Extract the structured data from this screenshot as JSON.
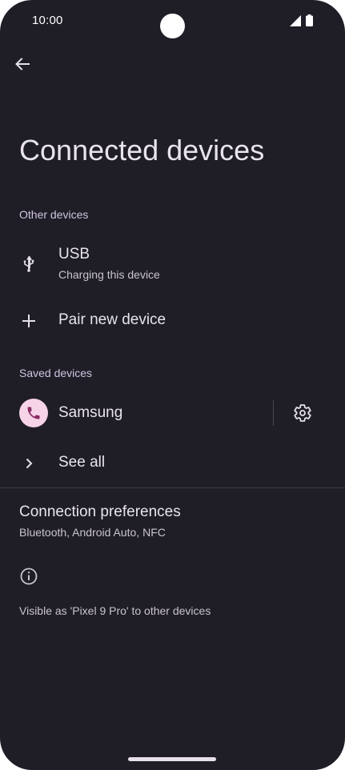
{
  "status_bar": {
    "time": "10:00"
  },
  "header": {
    "title": "Connected devices",
    "back_icon": "arrow-back-icon"
  },
  "sections": {
    "other_devices": "Other devices",
    "saved_devices": "Saved devices"
  },
  "usb": {
    "title": "USB",
    "subtitle": "Charging this device",
    "icon": "usb-icon"
  },
  "pair": {
    "title": "Pair new device",
    "icon": "plus-icon"
  },
  "saved_device": {
    "name": "Samsung",
    "icon": "phone-icon",
    "settings_icon": "gear-icon"
  },
  "see_all": {
    "label": "See all",
    "icon": "chevron-right-icon"
  },
  "preferences": {
    "title": "Connection preferences",
    "subtitle": "Bluetooth, Android Auto, NFC"
  },
  "footer": {
    "visible_as": "Visible as 'Pixel 9 Pro' to other devices",
    "icon": "info-icon"
  },
  "colors": {
    "background": "#1f1d26",
    "avatar_bg": "#f7d3e8",
    "avatar_fg": "#8a2e63",
    "section_header": "#cfc5e0"
  }
}
